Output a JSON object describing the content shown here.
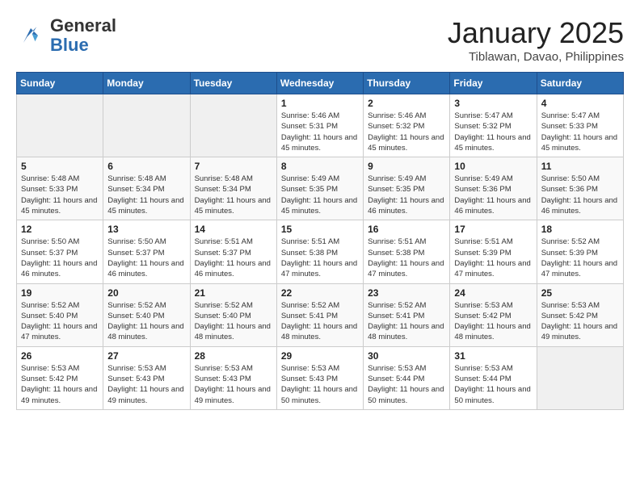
{
  "header": {
    "logo_line1": "General",
    "logo_line2": "Blue",
    "month": "January 2025",
    "location": "Tiblawan, Davao, Philippines"
  },
  "weekdays": [
    "Sunday",
    "Monday",
    "Tuesday",
    "Wednesday",
    "Thursday",
    "Friday",
    "Saturday"
  ],
  "weeks": [
    [
      {
        "day": "",
        "sunrise": "",
        "sunset": "",
        "daylight": ""
      },
      {
        "day": "",
        "sunrise": "",
        "sunset": "",
        "daylight": ""
      },
      {
        "day": "",
        "sunrise": "",
        "sunset": "",
        "daylight": ""
      },
      {
        "day": "1",
        "sunrise": "Sunrise: 5:46 AM",
        "sunset": "Sunset: 5:31 PM",
        "daylight": "Daylight: 11 hours and 45 minutes."
      },
      {
        "day": "2",
        "sunrise": "Sunrise: 5:46 AM",
        "sunset": "Sunset: 5:32 PM",
        "daylight": "Daylight: 11 hours and 45 minutes."
      },
      {
        "day": "3",
        "sunrise": "Sunrise: 5:47 AM",
        "sunset": "Sunset: 5:32 PM",
        "daylight": "Daylight: 11 hours and 45 minutes."
      },
      {
        "day": "4",
        "sunrise": "Sunrise: 5:47 AM",
        "sunset": "Sunset: 5:33 PM",
        "daylight": "Daylight: 11 hours and 45 minutes."
      }
    ],
    [
      {
        "day": "5",
        "sunrise": "Sunrise: 5:48 AM",
        "sunset": "Sunset: 5:33 PM",
        "daylight": "Daylight: 11 hours and 45 minutes."
      },
      {
        "day": "6",
        "sunrise": "Sunrise: 5:48 AM",
        "sunset": "Sunset: 5:34 PM",
        "daylight": "Daylight: 11 hours and 45 minutes."
      },
      {
        "day": "7",
        "sunrise": "Sunrise: 5:48 AM",
        "sunset": "Sunset: 5:34 PM",
        "daylight": "Daylight: 11 hours and 45 minutes."
      },
      {
        "day": "8",
        "sunrise": "Sunrise: 5:49 AM",
        "sunset": "Sunset: 5:35 PM",
        "daylight": "Daylight: 11 hours and 45 minutes."
      },
      {
        "day": "9",
        "sunrise": "Sunrise: 5:49 AM",
        "sunset": "Sunset: 5:35 PM",
        "daylight": "Daylight: 11 hours and 46 minutes."
      },
      {
        "day": "10",
        "sunrise": "Sunrise: 5:49 AM",
        "sunset": "Sunset: 5:36 PM",
        "daylight": "Daylight: 11 hours and 46 minutes."
      },
      {
        "day": "11",
        "sunrise": "Sunrise: 5:50 AM",
        "sunset": "Sunset: 5:36 PM",
        "daylight": "Daylight: 11 hours and 46 minutes."
      }
    ],
    [
      {
        "day": "12",
        "sunrise": "Sunrise: 5:50 AM",
        "sunset": "Sunset: 5:37 PM",
        "daylight": "Daylight: 11 hours and 46 minutes."
      },
      {
        "day": "13",
        "sunrise": "Sunrise: 5:50 AM",
        "sunset": "Sunset: 5:37 PM",
        "daylight": "Daylight: 11 hours and 46 minutes."
      },
      {
        "day": "14",
        "sunrise": "Sunrise: 5:51 AM",
        "sunset": "Sunset: 5:37 PM",
        "daylight": "Daylight: 11 hours and 46 minutes."
      },
      {
        "day": "15",
        "sunrise": "Sunrise: 5:51 AM",
        "sunset": "Sunset: 5:38 PM",
        "daylight": "Daylight: 11 hours and 47 minutes."
      },
      {
        "day": "16",
        "sunrise": "Sunrise: 5:51 AM",
        "sunset": "Sunset: 5:38 PM",
        "daylight": "Daylight: 11 hours and 47 minutes."
      },
      {
        "day": "17",
        "sunrise": "Sunrise: 5:51 AM",
        "sunset": "Sunset: 5:39 PM",
        "daylight": "Daylight: 11 hours and 47 minutes."
      },
      {
        "day": "18",
        "sunrise": "Sunrise: 5:52 AM",
        "sunset": "Sunset: 5:39 PM",
        "daylight": "Daylight: 11 hours and 47 minutes."
      }
    ],
    [
      {
        "day": "19",
        "sunrise": "Sunrise: 5:52 AM",
        "sunset": "Sunset: 5:40 PM",
        "daylight": "Daylight: 11 hours and 47 minutes."
      },
      {
        "day": "20",
        "sunrise": "Sunrise: 5:52 AM",
        "sunset": "Sunset: 5:40 PM",
        "daylight": "Daylight: 11 hours and 48 minutes."
      },
      {
        "day": "21",
        "sunrise": "Sunrise: 5:52 AM",
        "sunset": "Sunset: 5:40 PM",
        "daylight": "Daylight: 11 hours and 48 minutes."
      },
      {
        "day": "22",
        "sunrise": "Sunrise: 5:52 AM",
        "sunset": "Sunset: 5:41 PM",
        "daylight": "Daylight: 11 hours and 48 minutes."
      },
      {
        "day": "23",
        "sunrise": "Sunrise: 5:52 AM",
        "sunset": "Sunset: 5:41 PM",
        "daylight": "Daylight: 11 hours and 48 minutes."
      },
      {
        "day": "24",
        "sunrise": "Sunrise: 5:53 AM",
        "sunset": "Sunset: 5:42 PM",
        "daylight": "Daylight: 11 hours and 48 minutes."
      },
      {
        "day": "25",
        "sunrise": "Sunrise: 5:53 AM",
        "sunset": "Sunset: 5:42 PM",
        "daylight": "Daylight: 11 hours and 49 minutes."
      }
    ],
    [
      {
        "day": "26",
        "sunrise": "Sunrise: 5:53 AM",
        "sunset": "Sunset: 5:42 PM",
        "daylight": "Daylight: 11 hours and 49 minutes."
      },
      {
        "day": "27",
        "sunrise": "Sunrise: 5:53 AM",
        "sunset": "Sunset: 5:43 PM",
        "daylight": "Daylight: 11 hours and 49 minutes."
      },
      {
        "day": "28",
        "sunrise": "Sunrise: 5:53 AM",
        "sunset": "Sunset: 5:43 PM",
        "daylight": "Daylight: 11 hours and 49 minutes."
      },
      {
        "day": "29",
        "sunrise": "Sunrise: 5:53 AM",
        "sunset": "Sunset: 5:43 PM",
        "daylight": "Daylight: 11 hours and 50 minutes."
      },
      {
        "day": "30",
        "sunrise": "Sunrise: 5:53 AM",
        "sunset": "Sunset: 5:44 PM",
        "daylight": "Daylight: 11 hours and 50 minutes."
      },
      {
        "day": "31",
        "sunrise": "Sunrise: 5:53 AM",
        "sunset": "Sunset: 5:44 PM",
        "daylight": "Daylight: 11 hours and 50 minutes."
      },
      {
        "day": "",
        "sunrise": "",
        "sunset": "",
        "daylight": ""
      }
    ]
  ]
}
